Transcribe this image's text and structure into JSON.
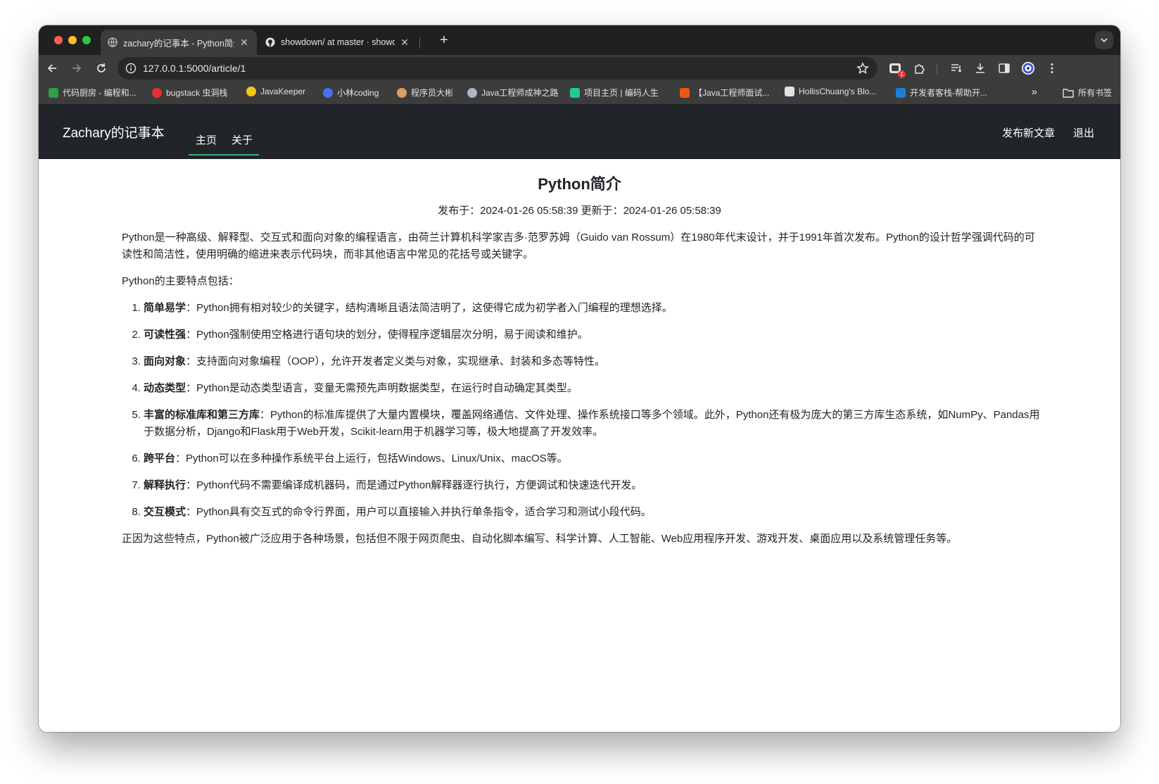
{
  "browser": {
    "tabs": [
      {
        "title": "zachary的记事本 - Python简介",
        "active": true,
        "favicon": "globe-icon"
      },
      {
        "title": "showdown/ at master · showdownjs",
        "active": false,
        "favicon": "github-icon"
      }
    ],
    "address": "127.0.0.1:5000/article/1",
    "bookmarks": [
      {
        "label": "代码厨房 - 编程和...",
        "color": "#2f9e44"
      },
      {
        "label": "bugstack 虫洞栈",
        "color": "#e03131"
      },
      {
        "label": "JavaKeeper",
        "color": "#f5c518"
      },
      {
        "label": "小林coding",
        "color": "#4c6ef5"
      },
      {
        "label": "程序员大彬",
        "color": "#d9a066"
      },
      {
        "label": "Java工程师成神之路",
        "color": "#adb5bd"
      },
      {
        "label": "项目主页 | 编码人生",
        "color": "#20c997"
      },
      {
        "label": "【Java工程师面试...",
        "color": "#e8590c"
      },
      {
        "label": "HollisChuang's Blo...",
        "color": "#dee2e6"
      },
      {
        "label": "开发者客栈-帮助开...",
        "color": "#1c7ed6"
      }
    ],
    "all_bookmarks": "所有书签",
    "extension_badge": "1"
  },
  "navbar": {
    "brand": "Zachary的记事本",
    "links": [
      "主页",
      "关于"
    ],
    "publish": "发布新文章",
    "logout": "退出",
    "accent_color": "#2fb573"
  },
  "article": {
    "title": "Python简介",
    "meta": "发布于：2024-01-26 05:58:39 更新于：2024-01-26 05:58:39",
    "intro": "Python是一种高级、解释型、交互式和面向对象的编程语言，由荷兰计算机科学家吉多·范罗苏姆（Guido van Rossum）在1980年代末设计，并于1991年首次发布。Python的设计哲学强调代码的可读性和简洁性，使用明确的缩进来表示代码块，而非其他语言中常见的花括号或关键字。",
    "features_heading": "Python的主要特点包括：",
    "features": [
      {
        "term": "简单易学",
        "desc": "：Python拥有相对较少的关键字，结构清晰且语法简洁明了，这使得它成为初学者入门编程的理想选择。"
      },
      {
        "term": "可读性强",
        "desc": "：Python强制使用空格进行语句块的划分，使得程序逻辑层次分明，易于阅读和维护。"
      },
      {
        "term": "面向对象",
        "desc": "：支持面向对象编程（OOP），允许开发者定义类与对象，实现继承、封装和多态等特性。"
      },
      {
        "term": "动态类型",
        "desc": "：Python是动态类型语言，变量无需预先声明数据类型，在运行时自动确定其类型。"
      },
      {
        "term": "丰富的标准库和第三方库",
        "desc": "：Python的标准库提供了大量内置模块，覆盖网络通信、文件处理、操作系统接口等多个领域。此外，Python还有极为庞大的第三方库生态系统，如NumPy、Pandas用于数据分析，Django和Flask用于Web开发，Scikit-learn用于机器学习等，极大地提高了开发效率。"
      },
      {
        "term": "跨平台",
        "desc": "：Python可以在多种操作系统平台上运行，包括Windows、Linux/Unix、macOS等。"
      },
      {
        "term": "解释执行",
        "desc": "：Python代码不需要编译成机器码，而是通过Python解释器逐行执行，方便调试和快速迭代开发。"
      },
      {
        "term": "交互模式",
        "desc": "：Python具有交互式的命令行界面，用户可以直接输入并执行单条指令，适合学习和测试小段代码。"
      }
    ],
    "conclusion": "正因为这些特点，Python被广泛应用于各种场景，包括但不限于网页爬虫、自动化脚本编写、科学计算、人工智能、Web应用程序开发、游戏开发、桌面应用以及系统管理任务等。"
  }
}
